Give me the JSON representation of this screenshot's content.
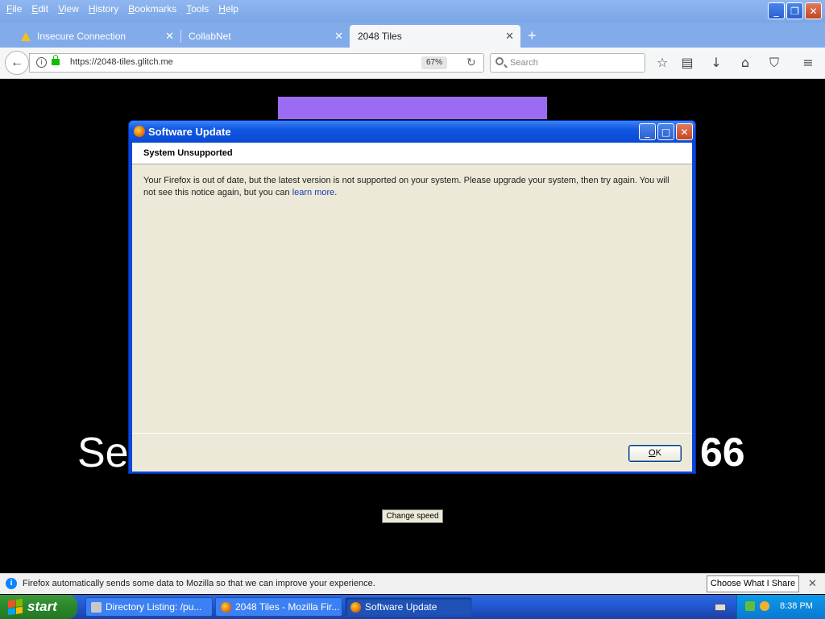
{
  "menubar": {
    "items": [
      {
        "accel": "F",
        "rest": "ile"
      },
      {
        "accel": "E",
        "rest": "dit"
      },
      {
        "accel": "V",
        "rest": "iew"
      },
      {
        "accel": "H",
        "rest": "istory"
      },
      {
        "accel": "B",
        "rest": "ookmarks"
      },
      {
        "accel": "T",
        "rest": "ools"
      },
      {
        "accel": "H",
        "rest": "elp"
      }
    ]
  },
  "tabs": [
    {
      "label": "Insecure Connection",
      "icon": "warning-icon"
    },
    {
      "label": "CollabNet"
    },
    {
      "label": "2048 Tiles",
      "active": true
    }
  ],
  "navbar": {
    "url": "https://2048-tiles.glitch.me",
    "zoom": "67%",
    "search_placeholder": "Search"
  },
  "page": {
    "big_text_left": "Se",
    "big_text_right": "66",
    "change_speed_label": "Change speed",
    "tile_color": "#9b6cf2"
  },
  "dialog": {
    "title": "Software Update",
    "heading": "System Unsupported",
    "message_before_link": "Your Firefox is out of date, but the latest version is not supported on your system. Please upgrade your system, then try again. You will not see this notice again, but you can ",
    "link_text": "learn more",
    "message_after_link": ".",
    "ok_accel": "O",
    "ok_rest": "K"
  },
  "notification": {
    "text": "Firefox automatically sends some data to Mozilla so that we can improve your experience.",
    "button_label": "Choose What I Share"
  },
  "taskbar": {
    "start_label": "start",
    "items": [
      {
        "label": "Directory Listing: /pu...",
        "icon": "directory-icon"
      },
      {
        "label": "2048 Tiles - Mozilla Fir...",
        "icon": "firefox-icon"
      },
      {
        "label": "Software Update",
        "icon": "firefox-icon",
        "active": true
      }
    ],
    "clock": "8:38 PM"
  }
}
